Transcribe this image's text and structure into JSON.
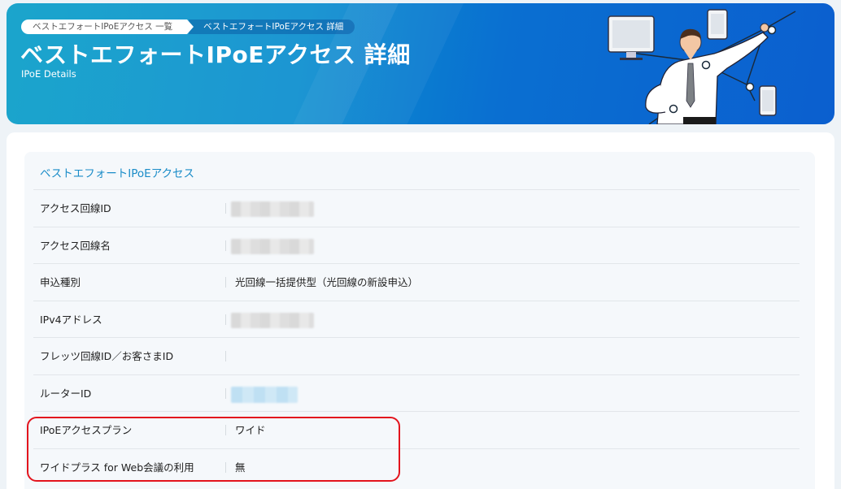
{
  "breadcrumb": {
    "items": [
      {
        "label": "ベストエフォートIPoEアクセス 一覧"
      },
      {
        "label": "ベストエフォートIPoEアクセス 詳細"
      }
    ]
  },
  "header": {
    "title": "ベストエフォートIPoEアクセス 詳細",
    "subtitle": "IPoE Details"
  },
  "card": {
    "title": "ベストエフォートIPoEアクセス",
    "rows": [
      {
        "label": "アクセス回線ID",
        "value": ""
      },
      {
        "label": "アクセス回線名",
        "value": ""
      },
      {
        "label": "申込種別",
        "value": "光回線一括提供型（光回線の新設申込）"
      },
      {
        "label": "IPv4アドレス",
        "value": ""
      },
      {
        "label": "フレッツ回線ID／お客さまID",
        "value": ""
      },
      {
        "label": "ルーターID",
        "value": ""
      },
      {
        "label": "IPoEアクセスプラン",
        "value": "ワイド"
      },
      {
        "label": "ワイドプラス for Web会議の利用",
        "value": "無"
      }
    ]
  },
  "colors": {
    "accent": "#1a8cc8",
    "hero_start": "#0a9fc9",
    "hero_end": "#0b5fcf",
    "highlight": "#e3141d"
  },
  "icons": {
    "hero_illustration": "businessman-network-illustration"
  }
}
